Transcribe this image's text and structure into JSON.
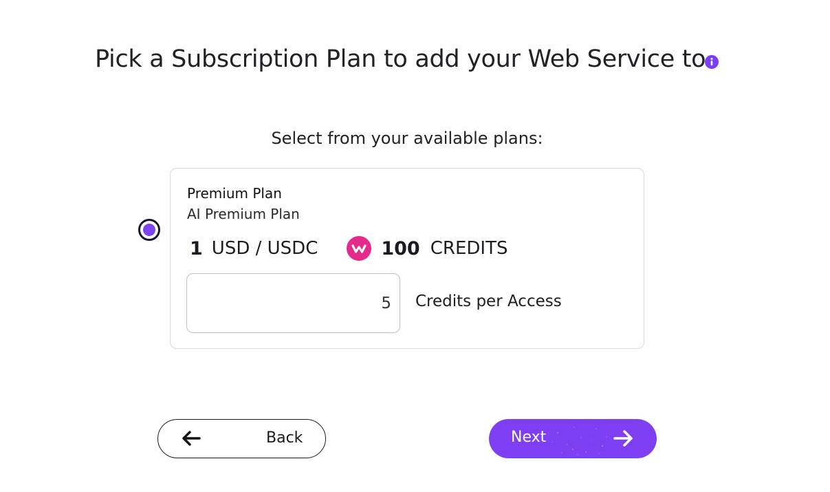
{
  "header": {
    "title": "Pick a Subscription Plan to add your Web Service to.",
    "info_icon": "info-icon"
  },
  "plans_section": {
    "subtitle": "Select from your available plans:"
  },
  "plan": {
    "selected": true,
    "name": "Premium Plan",
    "description": "AI Premium Plan",
    "price_amount": "1",
    "price_currency": "USD / USDC",
    "credits_icon": "credits-token-icon",
    "credits_amount": "100",
    "credits_label": "CREDITS",
    "credits_per_access_value": "5",
    "credits_per_access_label": "Credits per Access"
  },
  "navigation": {
    "back_label": "Back",
    "next_label": "Next"
  },
  "colors": {
    "accent": "#7d3ff1",
    "credits_token": "#e62a8c",
    "text": "#1b1b1f"
  }
}
